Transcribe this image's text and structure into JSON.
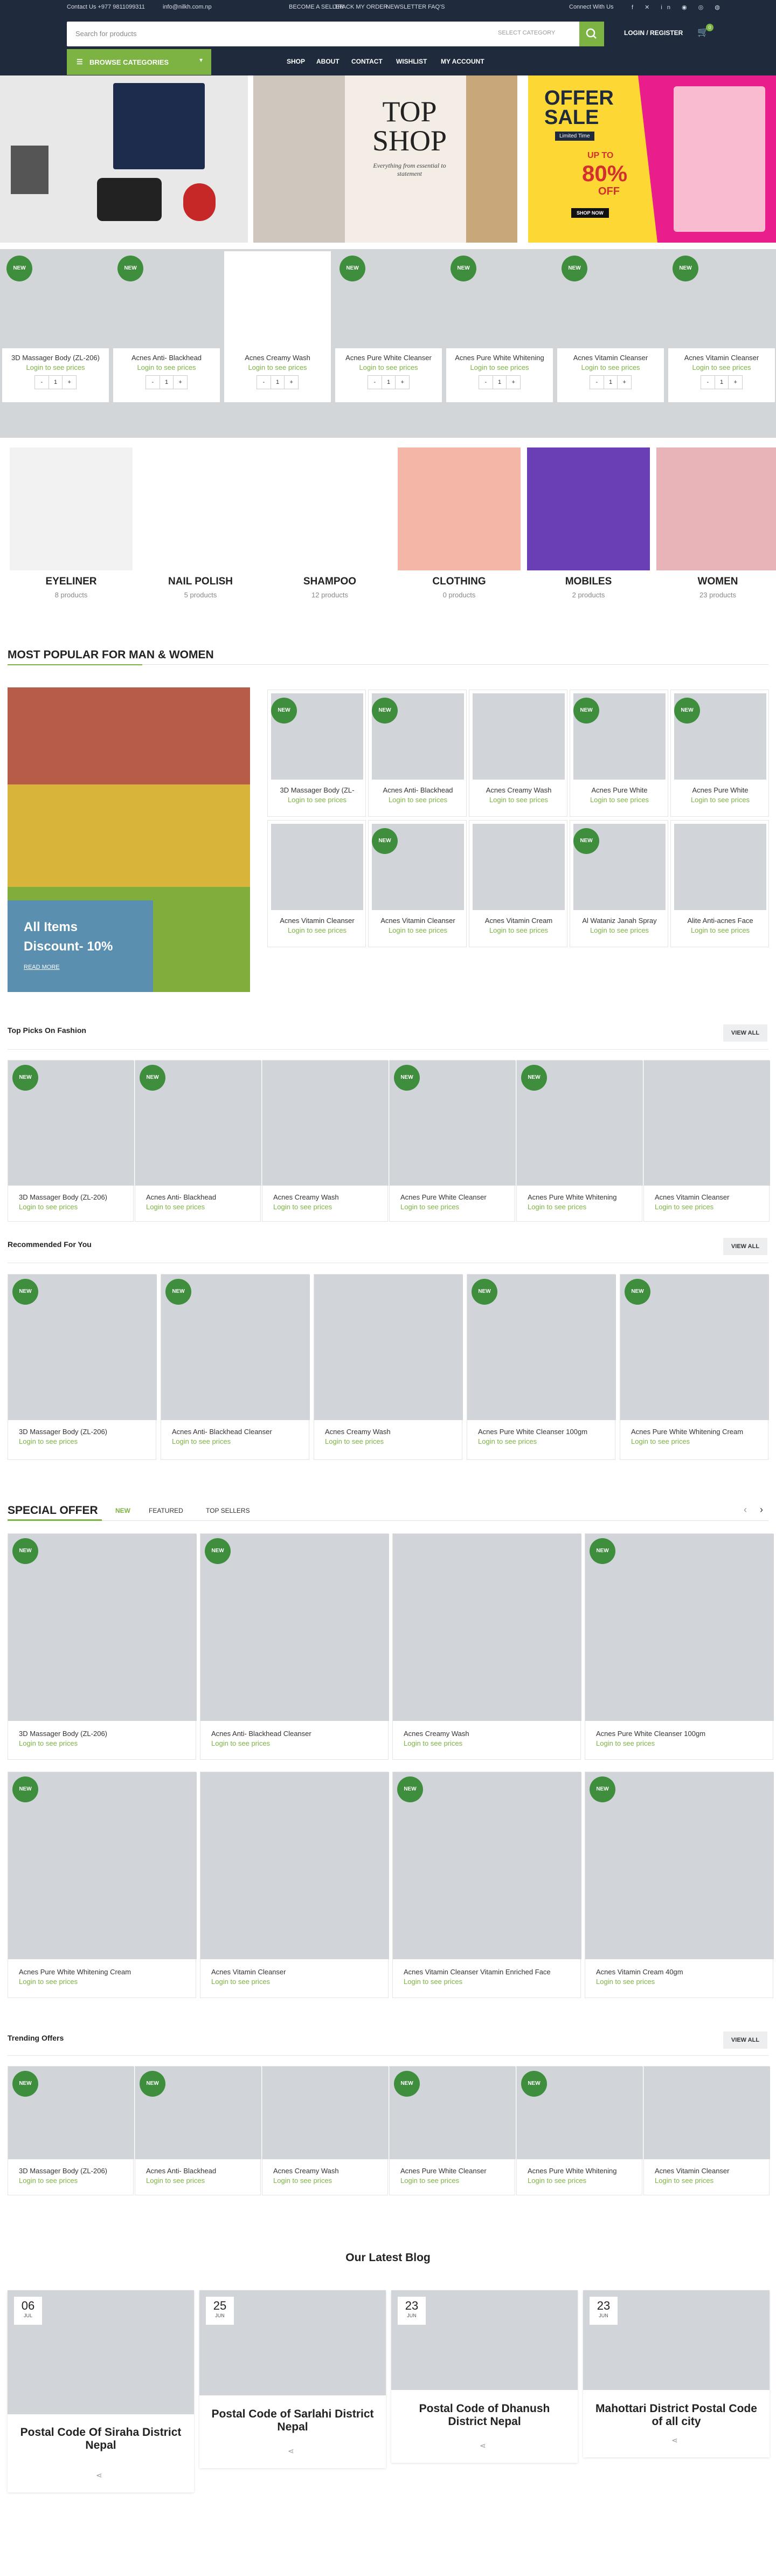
{
  "topbar": {
    "contact": "Contact Us +977 9811099311",
    "email": "info@nilkh.com.np",
    "links": [
      "BECOME A SELLER",
      "TRACK MY ORDER",
      "NEWSLETTER",
      "FAQ'S"
    ],
    "connect": "Connect With Us"
  },
  "header": {
    "search_placeholder": "Search for products",
    "category": "SELECT CATEGORY",
    "login": "LOGIN / REGISTER",
    "cart_count": "0",
    "browse": "BROWSE CATEGORIES",
    "nav": [
      "SHOP",
      "ABOUT",
      "CONTACT",
      "WISHLIST",
      "MY ACCOUNT"
    ]
  },
  "hero": {
    "banner2_title": "TOP SHOP",
    "banner2_sub": "Everything from essential to statement",
    "banner3_offer": "OFFER SALE",
    "banner3_limited": "Limited Time",
    "banner3_upto": "UP TO",
    "banner3_pct": "80%",
    "banner3_off": "OFF",
    "banner3_btn": "SHOP NOW"
  },
  "badge": "NEW",
  "qty_default": "1",
  "login_price": "Login to see prices",
  "row1": [
    "3D Massager Body (ZL-206)",
    "Acnes Anti- Blackhead",
    "Acnes Creamy Wash",
    "Acnes Pure White Cleanser",
    "Acnes Pure White Whitening",
    "Acnes Vitamin Cleanser",
    "Acnes Vitamin Cleanser"
  ],
  "categories": [
    {
      "name": "EYELINER",
      "count": "8 products"
    },
    {
      "name": "NAIL POLISH",
      "count": "5 products"
    },
    {
      "name": "SHAMPOO",
      "count": "12 products"
    },
    {
      "name": "CLOTHING",
      "count": "0 products"
    },
    {
      "name": "MOBILES",
      "count": "2 products"
    },
    {
      "name": "WOMEN",
      "count": "23 products"
    }
  ],
  "popular": {
    "title": "MOST POPULAR FOR MAN & WOMEN",
    "promo_title": "All Items",
    "promo_sub": "Discount- 10%",
    "promo_link": "READ MORE",
    "items": [
      "3D Massager Body (ZL-",
      "Acnes Anti- Blackhead",
      "Acnes Creamy Wash",
      "Acnes Pure White",
      "Acnes Pure White",
      "Acnes Vitamin Cleanser",
      "Acnes Vitamin Cleanser",
      "Acnes Vitamin Cream",
      "Al Wataniz Janah Spray",
      "Alite Anti-acnes Face"
    ]
  },
  "toppicks": {
    "title": "Top Picks On Fashion",
    "view_all": "VIEW ALL",
    "items": [
      "3D Massager Body (ZL-206)",
      "Acnes Anti- Blackhead",
      "Acnes Creamy Wash",
      "Acnes Pure White Cleanser",
      "Acnes Pure White Whitening",
      "Acnes Vitamin Cleanser"
    ]
  },
  "recommended": {
    "title": "Recommended For You",
    "view_all": "VIEW ALL",
    "items": [
      "3D Massager Body (ZL-206)",
      "Acnes Anti- Blackhead Cleanser",
      "Acnes Creamy Wash",
      "Acnes Pure White Cleanser 100gm",
      "Acnes Pure White Whitening Cream"
    ]
  },
  "special": {
    "title": "SPECIAL OFFER",
    "tabs": [
      "NEW",
      "FEATURED",
      "TOP SELLERS"
    ],
    "items": [
      "3D Massager Body (ZL-206)",
      "Acnes Anti- Blackhead Cleanser",
      "Acnes Creamy Wash",
      "Acnes Pure White Cleanser 100gm",
      "Acnes Pure White Whitening Cream",
      "Acnes Vitamin Cleanser",
      "Acnes Vitamin Cleanser Vitamin Enriched Face",
      "Acnes Vitamin Cream 40gm"
    ]
  },
  "trending": {
    "title": "Trending Offers",
    "view_all": "VIEW ALL",
    "items": [
      "3D Massager Body (ZL-206)",
      "Acnes Anti- Blackhead",
      "Acnes Creamy Wash",
      "Acnes Pure White Cleanser",
      "Acnes Pure White Whitening",
      "Acnes Vitamin Cleanser"
    ]
  },
  "blog": {
    "title": "Our Latest Blog",
    "posts": [
      {
        "day": "06",
        "month": "JUL",
        "title": "Postal Code Of Siraha District Nepal"
      },
      {
        "day": "25",
        "month": "JUN",
        "title": "Postal Code of Sarlahi District Nepal"
      },
      {
        "day": "23",
        "month": "JUN",
        "title": "Postal Code of Dhanush District Nepal"
      },
      {
        "day": "23",
        "month": "JUN",
        "title": "Mahottari District Postal Code of all city"
      }
    ]
  },
  "colors": {
    "accent": "#7cb342",
    "dark": "#1f2a3c",
    "badge": "#3e8e3e"
  }
}
